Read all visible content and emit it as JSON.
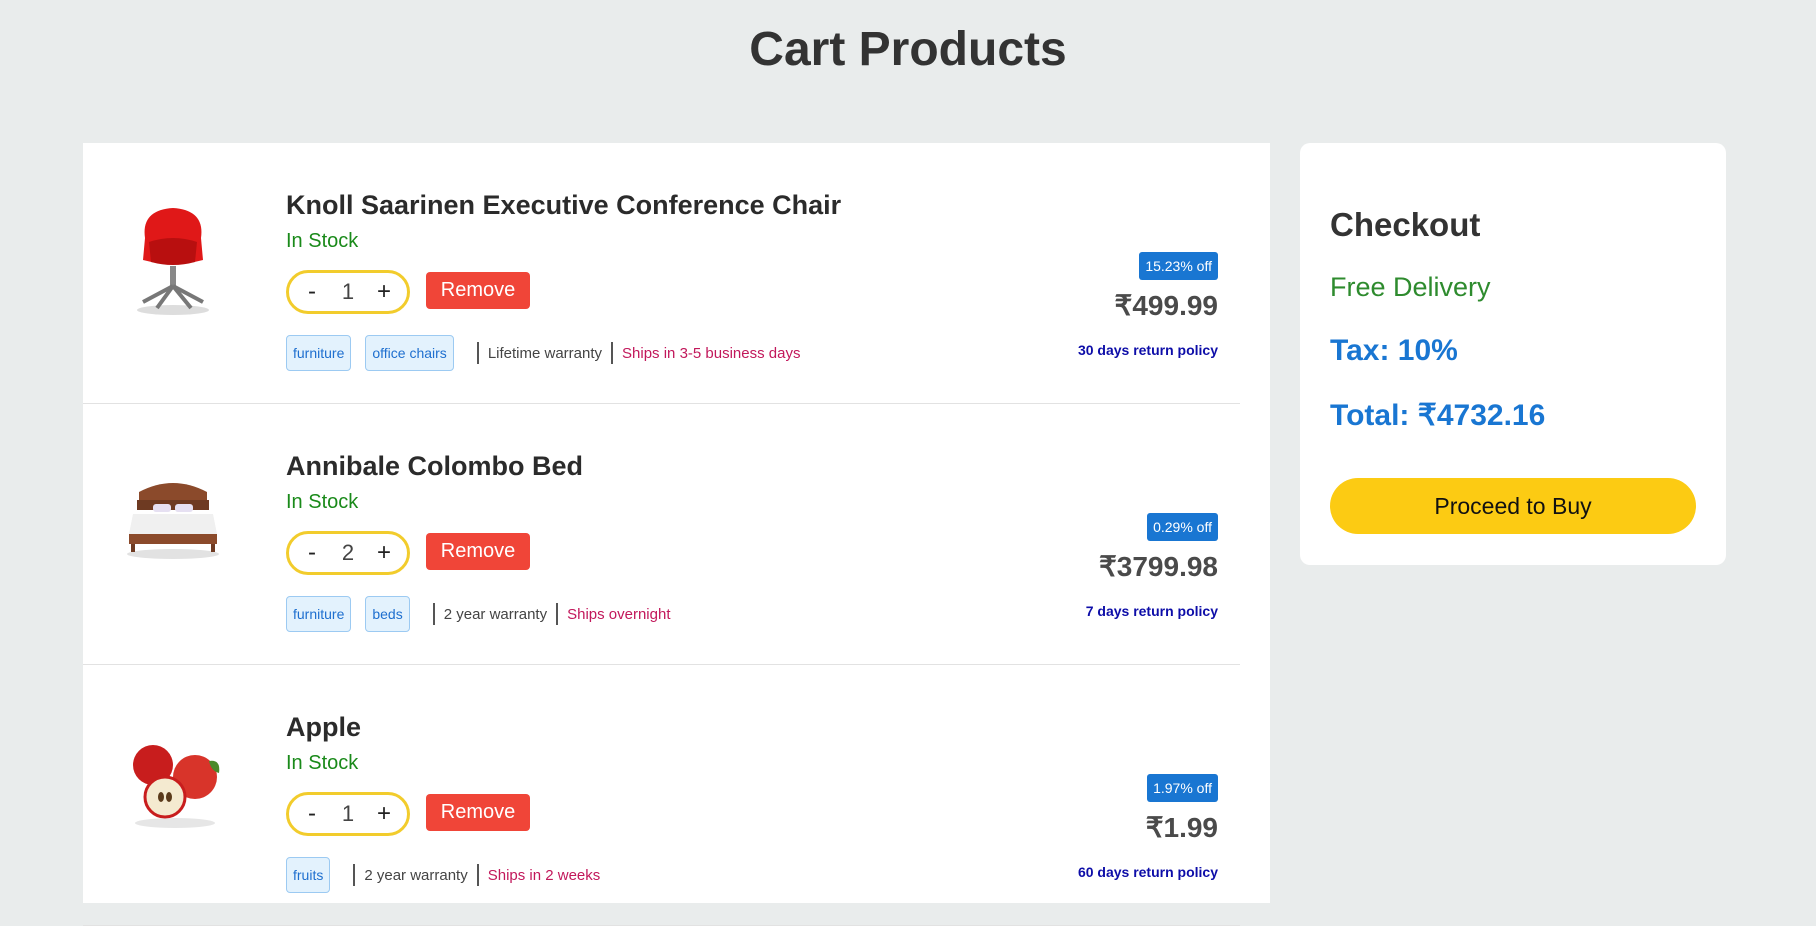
{
  "page": {
    "title": "Cart Products"
  },
  "items": [
    {
      "name": "Knoll Saarinen Executive Conference Chair",
      "stock": "In Stock",
      "qty_minus": "-",
      "quantity": "1",
      "qty_plus": "+",
      "remove_label": "Remove",
      "tags": [
        "furniture",
        "office chairs"
      ],
      "warranty": "Lifetime warranty",
      "shipping": "Ships in 3-5 business days",
      "discount": "15.23% off",
      "price": "₹499.99",
      "return_policy": "30 days return policy",
      "thumb_icon": "office-chair-icon"
    },
    {
      "name": "Annibale Colombo Bed",
      "stock": "In Stock",
      "qty_minus": "-",
      "quantity": "2",
      "qty_plus": "+",
      "remove_label": "Remove",
      "tags": [
        "furniture",
        "beds"
      ],
      "warranty": "2 year warranty",
      "shipping": "Ships overnight",
      "discount": "0.29% off",
      "price": "₹3799.98",
      "return_policy": "7 days return policy",
      "thumb_icon": "bed-icon"
    },
    {
      "name": "Apple",
      "stock": "In Stock",
      "qty_minus": "-",
      "quantity": "1",
      "qty_plus": "+",
      "remove_label": "Remove",
      "tags": [
        "fruits"
      ],
      "warranty": "2 year warranty",
      "shipping": "Ships in 2 weeks",
      "discount": "1.97% off",
      "price": "₹1.99",
      "return_policy": "60 days return policy",
      "thumb_icon": "apple-icon"
    }
  ],
  "checkout": {
    "title": "Checkout",
    "delivery": "Free Delivery",
    "tax": "Tax: 10%",
    "total": "Total: ₹4732.16",
    "buy_label": "Proceed to Buy"
  },
  "colors": {
    "background": "#e9ecec",
    "in_stock": "#1a8a1a",
    "remove": "#f04538",
    "discount_badge": "#1976d2",
    "buy_button": "#fccb13",
    "quantity_border": "#f2cc2c"
  }
}
